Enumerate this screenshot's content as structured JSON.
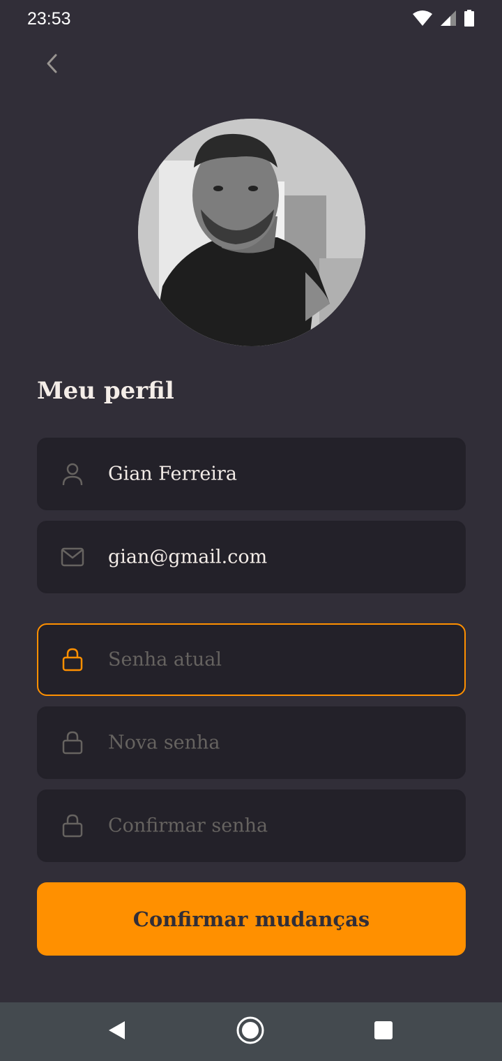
{
  "status_bar": {
    "time": "23:53",
    "icons": [
      "wifi-icon",
      "signal-icon",
      "battery-icon"
    ]
  },
  "header": {
    "back_icon": "chevron-left-icon"
  },
  "profile": {
    "avatar": "profile-photo",
    "title": "Meu perfil"
  },
  "form": {
    "name": {
      "icon": "user-icon",
      "value": "Gian Ferreira"
    },
    "email": {
      "icon": "mail-icon",
      "value": "gian@gmail.com"
    },
    "current_password": {
      "icon": "lock-icon",
      "placeholder": "Senha atual",
      "focused": true
    },
    "new_password": {
      "icon": "lock-icon",
      "placeholder": "Nova senha"
    },
    "confirm_password": {
      "icon": "lock-icon",
      "placeholder": "Confirmar senha"
    },
    "submit_label": "Confirmar mudanças"
  },
  "colors": {
    "background": "#312e38",
    "input_background": "#232129",
    "accent": "#ff9000",
    "text": "#f4ede8",
    "placeholder": "#666360",
    "nav_bar": "#444a4f"
  },
  "nav_bar": {
    "buttons": [
      "back-triangle-icon",
      "home-circle-icon",
      "recents-square-icon"
    ]
  }
}
